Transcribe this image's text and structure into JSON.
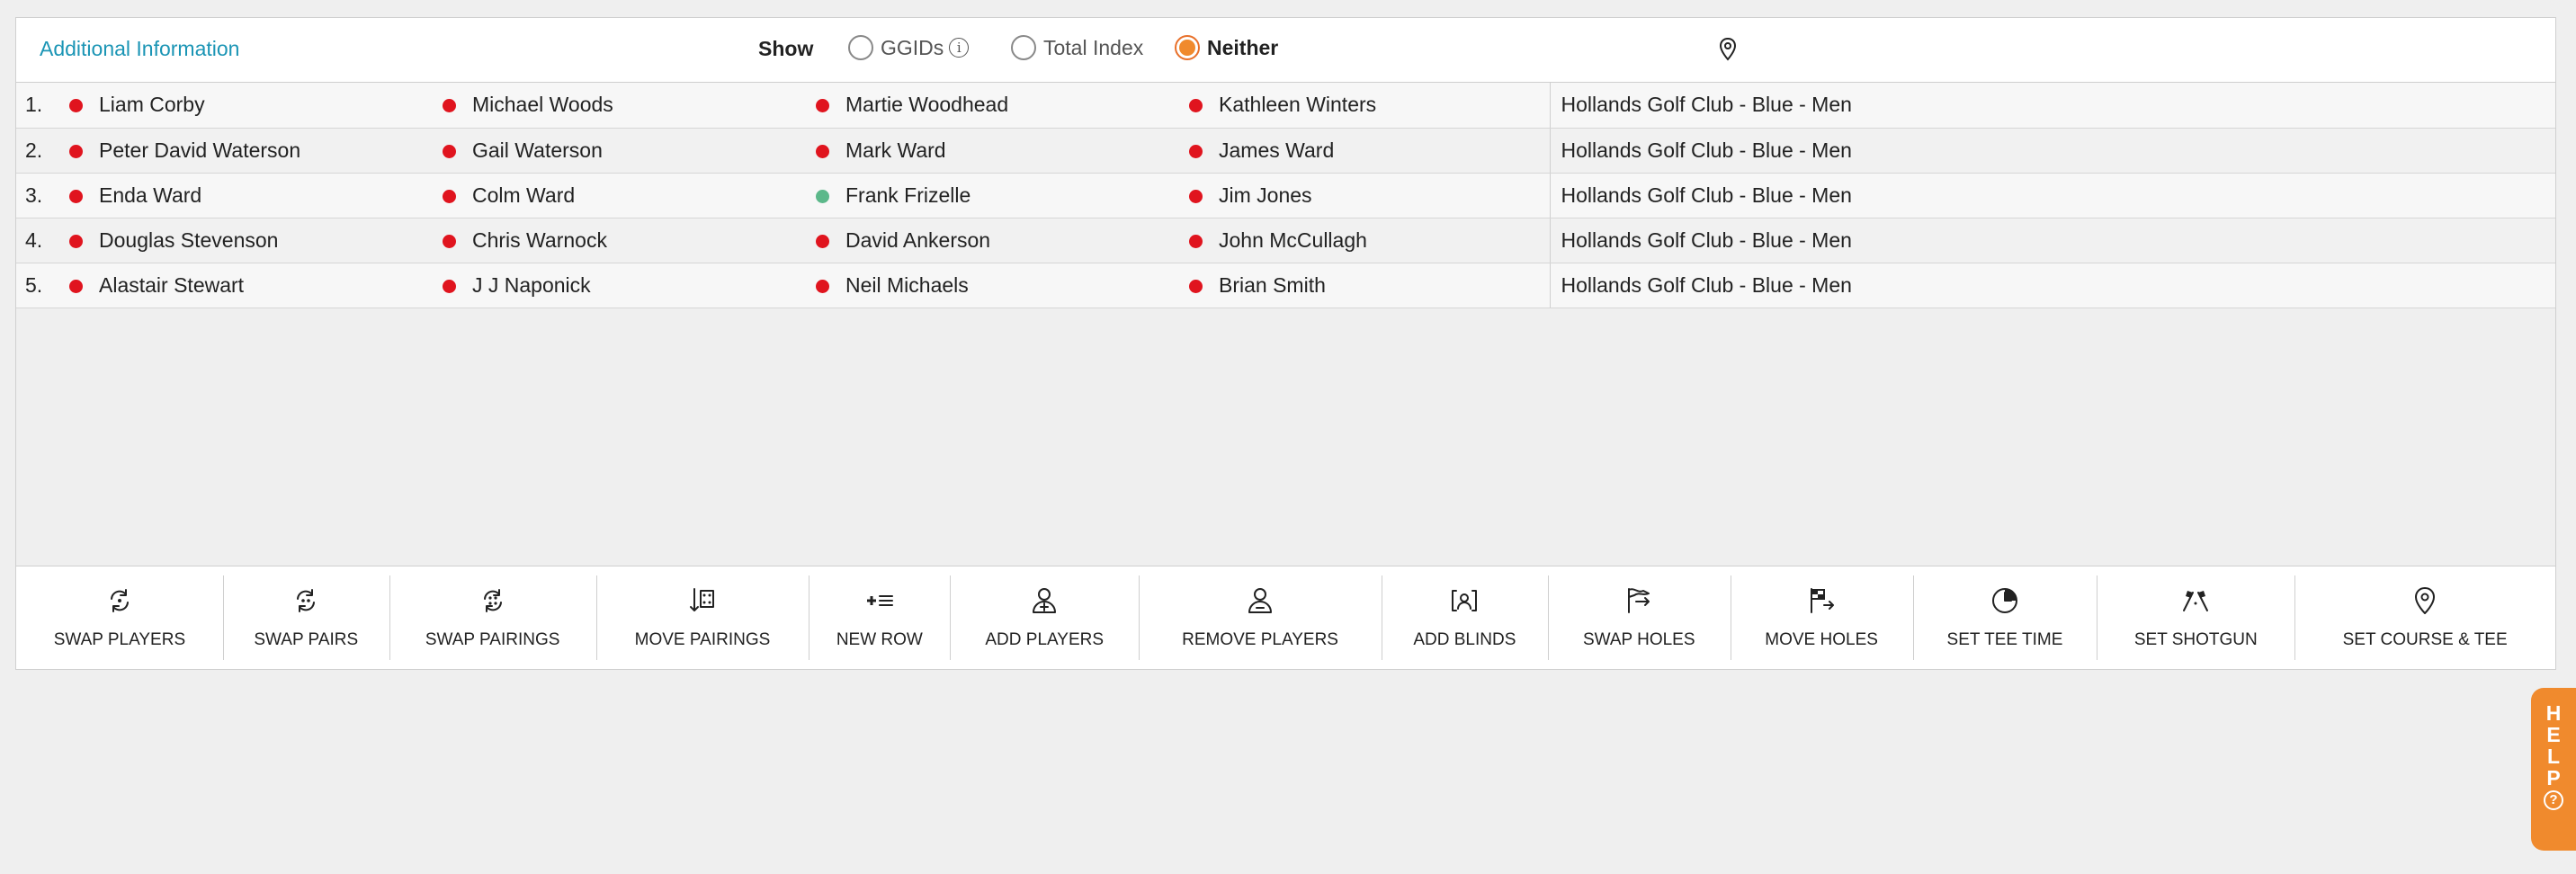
{
  "info_bar": {
    "title": "Additional Information",
    "show_label": "Show",
    "options": [
      {
        "label": "GGIDs",
        "selected": false
      },
      {
        "label": "Total Index",
        "selected": false
      },
      {
        "label": "Neither",
        "selected": true
      }
    ],
    "info_icon": "i"
  },
  "rows": [
    {
      "num": "1.",
      "players": [
        {
          "name": "Liam Corby",
          "status": "red"
        },
        {
          "name": "Michael Woods",
          "status": "red"
        },
        {
          "name": "Martie Woodhead",
          "status": "red"
        },
        {
          "name": "Kathleen Winters",
          "status": "red"
        }
      ],
      "course": "Hollands Golf Club - Blue - Men"
    },
    {
      "num": "2.",
      "players": [
        {
          "name": "Peter David Waterson",
          "status": "red"
        },
        {
          "name": "Gail Waterson",
          "status": "red"
        },
        {
          "name": "Mark Ward",
          "status": "red"
        },
        {
          "name": "James Ward",
          "status": "red"
        }
      ],
      "course": "Hollands Golf Club - Blue - Men"
    },
    {
      "num": "3.",
      "players": [
        {
          "name": "Enda Ward",
          "status": "red"
        },
        {
          "name": "Colm Ward",
          "status": "red"
        },
        {
          "name": "Frank Frizelle",
          "status": "green"
        },
        {
          "name": "Jim Jones",
          "status": "red"
        }
      ],
      "course": "Hollands Golf Club - Blue - Men"
    },
    {
      "num": "4.",
      "players": [
        {
          "name": "Douglas Stevenson",
          "status": "red"
        },
        {
          "name": "Chris Warnock",
          "status": "red"
        },
        {
          "name": "David Ankerson",
          "status": "red"
        },
        {
          "name": "John McCullagh",
          "status": "red"
        }
      ],
      "course": "Hollands Golf Club - Blue - Men"
    },
    {
      "num": "5.",
      "players": [
        {
          "name": "Alastair Stewart",
          "status": "red"
        },
        {
          "name": "J J Naponick",
          "status": "red"
        },
        {
          "name": "Neil Michaels",
          "status": "red"
        },
        {
          "name": "Brian Smith",
          "status": "red"
        }
      ],
      "course": "Hollands Golf Club - Blue - Men"
    }
  ],
  "toolbar": [
    {
      "label": "SWAP PLAYERS",
      "icon": "swap-players-icon"
    },
    {
      "label": "SWAP PAIRS",
      "icon": "swap-pairs-icon"
    },
    {
      "label": "SWAP PAIRINGS",
      "icon": "swap-pairings-icon"
    },
    {
      "label": "MOVE PAIRINGS",
      "icon": "move-pairings-icon"
    },
    {
      "label": "NEW ROW",
      "icon": "new-row-icon"
    },
    {
      "label": "ADD PLAYERS",
      "icon": "add-player-icon"
    },
    {
      "label": "REMOVE PLAYERS",
      "icon": "remove-player-icon"
    },
    {
      "label": "ADD BLINDS",
      "icon": "add-blinds-icon"
    },
    {
      "label": "SWAP HOLES",
      "icon": "swap-holes-flag-icon"
    },
    {
      "label": "MOVE HOLES",
      "icon": "move-holes-flag-icon"
    },
    {
      "label": "SET TEE TIME",
      "icon": "clock-icon"
    },
    {
      "label": "SET SHOTGUN",
      "icon": "shotgun-flags-icon"
    },
    {
      "label": "SET COURSE & TEE",
      "icon": "map-pin-icon"
    }
  ],
  "help": {
    "letters": [
      "H",
      "E",
      "L",
      "P"
    ],
    "icon": "?"
  },
  "colors": {
    "accent": "#f08a2d",
    "link": "#1b95b5",
    "status_red": "#e0141e",
    "status_green": "#5cb88a"
  }
}
